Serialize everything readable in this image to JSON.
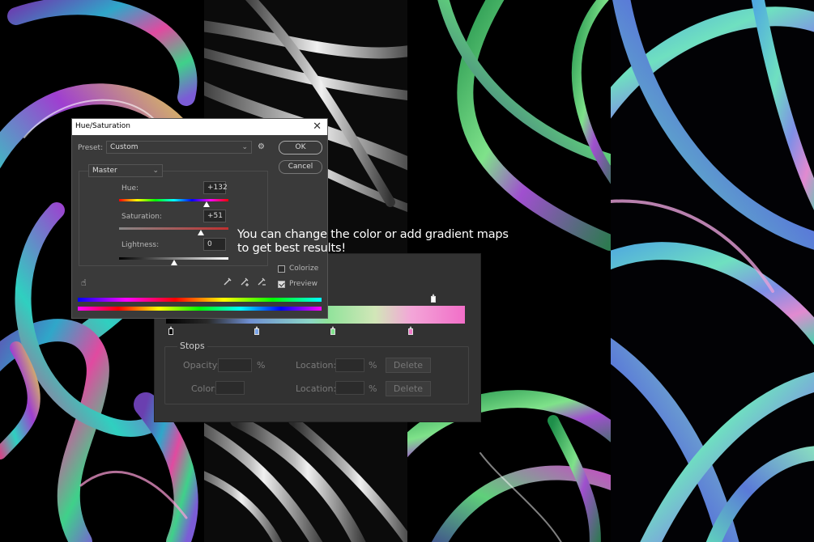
{
  "caption": {
    "line1": "You can change the color or add gradient maps",
    "line2": "to get best results!"
  },
  "hue_sat": {
    "title": "Hue/Saturation",
    "preset_label": "Preset:",
    "preset_value": "Custom",
    "ok_label": "OK",
    "cancel_label": "Cancel",
    "channel_value": "Master",
    "hue_label": "Hue:",
    "hue_value": "+132",
    "saturation_label": "Saturation:",
    "saturation_value": "+51",
    "lightness_label": "Lightness:",
    "lightness_value": "0",
    "colorize_label": "Colorize",
    "preview_label": "Preview",
    "colorize_checked": false,
    "preview_checked": true,
    "hue_level": 0.8,
    "saturation_level": 0.75,
    "lightness_level": 0.5
  },
  "gradient_editor": {
    "stops_title": "Stops",
    "opacity_label": "Opacity:",
    "color_label": "Color:",
    "location_label": "Location:",
    "percent_symbol": "%",
    "delete_label": "Delete",
    "stop_colors": [
      "#000000",
      "#7aa4e8",
      "#7fe38c",
      "#f07ac8"
    ],
    "opacity_stop_color": "#ffffff"
  },
  "icons": [
    "hand-adjust-icon",
    "eyedropper-icon",
    "eyedropper-plus-icon",
    "eyedropper-minus-icon",
    "gear-icon",
    "close-icon",
    "chevron-down-icon"
  ]
}
